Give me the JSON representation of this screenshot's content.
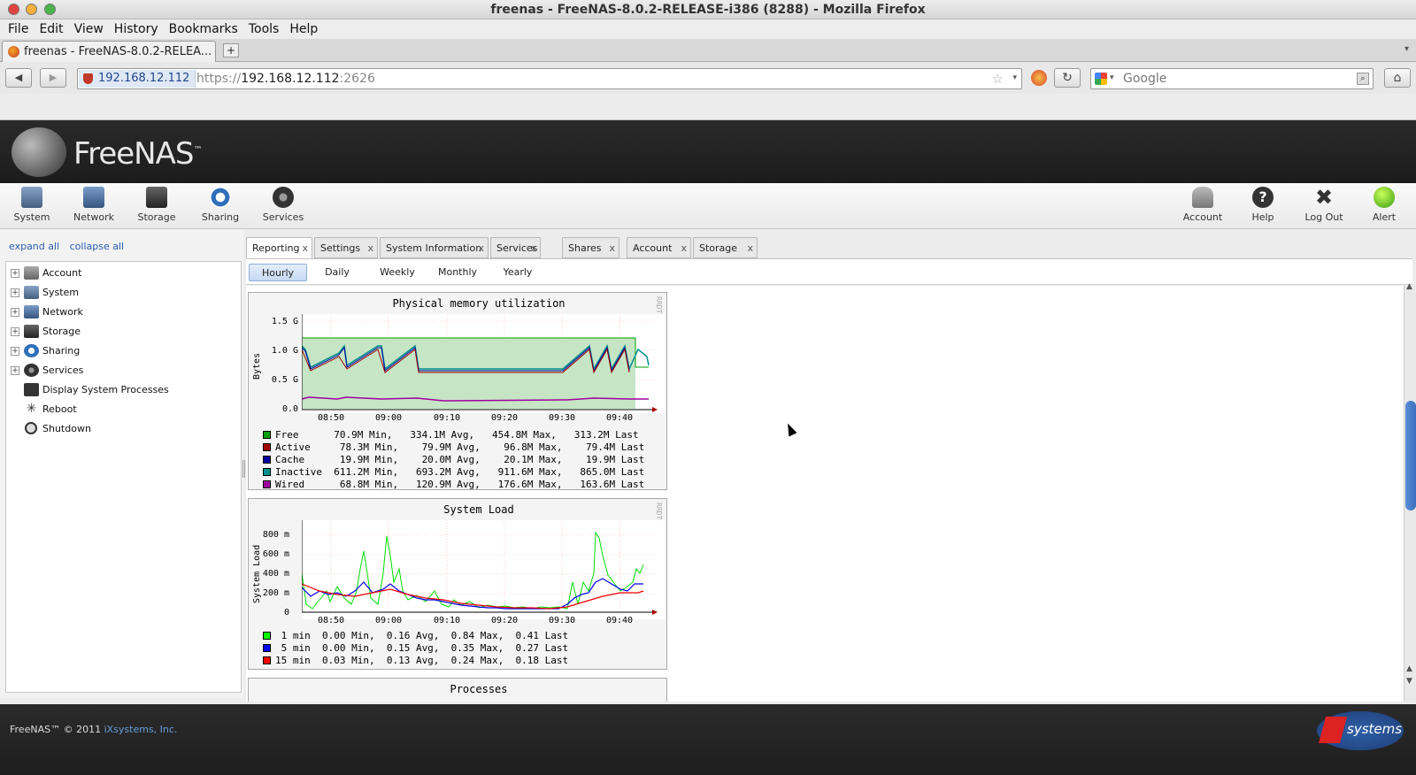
{
  "window": {
    "title": "freenas - FreeNAS-8.0.2-RELEASE-i386 (8288) - Mozilla Firefox"
  },
  "menubar": [
    "File",
    "Edit",
    "View",
    "History",
    "Bookmarks",
    "Tools",
    "Help"
  ],
  "browser_tab": {
    "label": "freenas - FreeNAS-8.0.2-RELEA..."
  },
  "navbar": {
    "site_identity": "192.168.12.112",
    "url_prefix": "https://",
    "url_host": "192.168.12.112",
    "url_port": ":2626",
    "search_placeholder": "Google"
  },
  "app": {
    "logo_text": "FreeNAS",
    "logo_tm": "™"
  },
  "toolbar": {
    "left": [
      {
        "label": "System",
        "icon": "system-icon"
      },
      {
        "label": "Network",
        "icon": "network-icon"
      },
      {
        "label": "Storage",
        "icon": "storage-icon"
      },
      {
        "label": "Sharing",
        "icon": "sharing-icon"
      },
      {
        "label": "Services",
        "icon": "services-icon"
      }
    ],
    "right": [
      {
        "label": "Account",
        "icon": "account-icon"
      },
      {
        "label": "Help",
        "icon": "help-icon"
      },
      {
        "label": "Log Out",
        "icon": "logout-icon"
      },
      {
        "label": "Alert",
        "icon": "alert-icon"
      }
    ]
  },
  "tree": {
    "expand_all": "expand all",
    "collapse_all": "collapse all",
    "items": [
      {
        "label": "Account",
        "expandable": true
      },
      {
        "label": "System",
        "expandable": true
      },
      {
        "label": "Network",
        "expandable": true
      },
      {
        "label": "Storage",
        "expandable": true
      },
      {
        "label": "Sharing",
        "expandable": true
      },
      {
        "label": "Services",
        "expandable": true
      },
      {
        "label": "Display System Processes",
        "expandable": false
      },
      {
        "label": "Reboot",
        "expandable": false
      },
      {
        "label": "Shutdown",
        "expandable": false
      }
    ]
  },
  "tabs": [
    "Reporting",
    "Settings",
    "System Information",
    "Services",
    "Shares",
    "Account",
    "Storage"
  ],
  "close_glyph": "x",
  "subtabs": [
    "Hourly",
    "Daily",
    "Weekly",
    "Monthly",
    "Yearly"
  ],
  "rrd_watermark": "RRDTOOL / TOBI OETIKER",
  "graphs": {
    "memory": {
      "title": "Physical memory utilization",
      "ylabel": "Bytes",
      "yticks": [
        "1.5 G",
        "1.0 G",
        "0.5 G",
        "0.0"
      ],
      "xticks": [
        "08:50",
        "09:00",
        "09:10",
        "09:20",
        "09:30",
        "09:40"
      ],
      "legend": [
        {
          "name": "Free",
          "text": "Free      70.9M Min,   334.1M Avg,   454.8M Max,   313.2M Last",
          "color": "#00a000"
        },
        {
          "name": "Active",
          "text": "Active     78.3M Min,    79.9M Avg,    96.8M Max,    79.4M Last",
          "color": "#a00000"
        },
        {
          "name": "Cache",
          "text": "Cache      19.9M Min,    20.0M Avg,    20.1M Max,    19.9M Last",
          "color": "#0000a0"
        },
        {
          "name": "Inactive",
          "text": "Inactive  611.2M Min,   693.2M Avg,   911.6M Max,   865.0M Last",
          "color": "#008f8f"
        },
        {
          "name": "Wired",
          "text": "Wired      68.8M Min,   120.9M Avg,   176.6M Max,   163.6M Last",
          "color": "#a000a0"
        }
      ]
    },
    "load": {
      "title": "System Load",
      "ylabel": "System Load",
      "yticks": [
        "800 m",
        "600 m",
        "400 m",
        "200 m",
        "0"
      ],
      "xticks": [
        "08:50",
        "09:00",
        "09:10",
        "09:20",
        "09:30",
        "09:40"
      ],
      "legend": [
        {
          "name": "1 min",
          "text": " 1 min  0.00 Min,  0.16 Avg,  0.84 Max,  0.41 Last",
          "color": "#00ff00"
        },
        {
          "name": "5 min",
          "text": " 5 min  0.00 Min,  0.15 Avg,  0.35 Max,  0.27 Last",
          "color": "#0000ff"
        },
        {
          "name": "15 min",
          "text": "15 min  0.03 Min,  0.13 Avg,  0.24 Max,  0.18 Last",
          "color": "#ff0000"
        }
      ]
    },
    "processes": {
      "title": "Processes"
    }
  },
  "footer": {
    "copyright": "FreeNAS™ © 2011 ",
    "company": "iXsystems, Inc.",
    "logo_text": "systems"
  }
}
